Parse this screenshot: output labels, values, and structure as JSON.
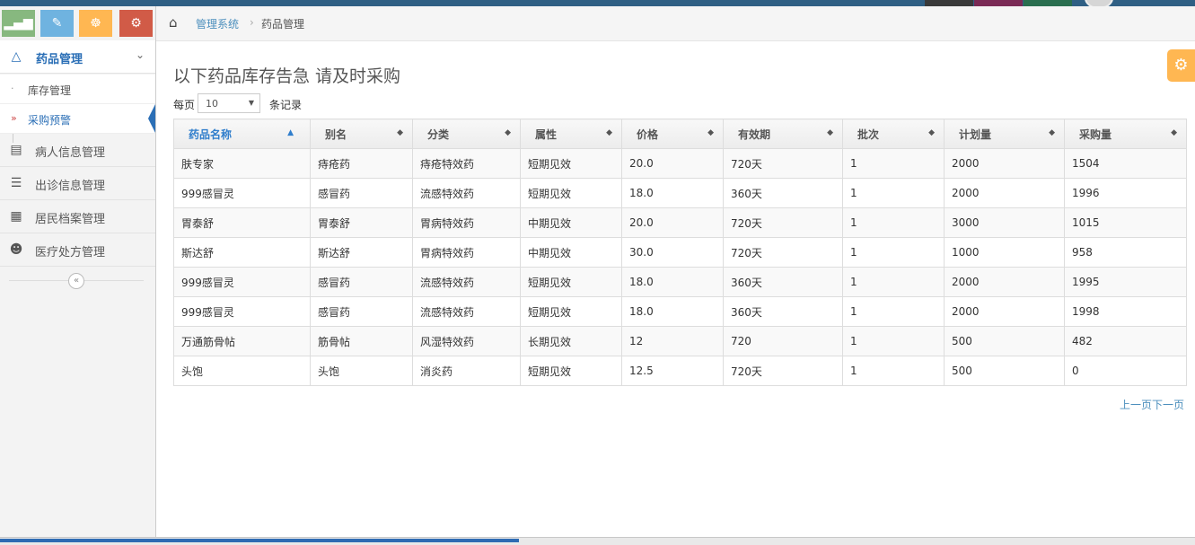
{
  "colors": {
    "accent": "#2b6fb6",
    "topbar": "#2f5f84",
    "shortcut_green": "#87b87f",
    "shortcut_blue": "#6fb3e0",
    "shortcut_orange": "#ffb752",
    "shortcut_red": "#d15b47"
  },
  "shortcuts": [
    {
      "icon": "signal-icon"
    },
    {
      "icon": "pencil-icon"
    },
    {
      "icon": "users-icon"
    },
    {
      "icon": "cogs-icon"
    }
  ],
  "sidebar": {
    "open_menu": {
      "label": "药品管理",
      "icon": "flask-icon"
    },
    "submenu": [
      {
        "label": "库存管理",
        "active": false
      },
      {
        "label": "采购预警",
        "active": true
      }
    ],
    "items": [
      {
        "label": "病人信息管理",
        "icon": "bar-chart-icon"
      },
      {
        "label": "出诊信息管理",
        "icon": "barcode-icon"
      },
      {
        "label": "居民档案管理",
        "icon": "book-icon"
      },
      {
        "label": "医疗处方管理",
        "icon": "group-icon"
      }
    ]
  },
  "breadcrumb": {
    "root": "管理系统",
    "current": "药品管理"
  },
  "main": {
    "title": "以下药品库存告急 请及时采购",
    "per_page_label": "每页",
    "per_page_value": "10",
    "per_page_suffix": "条记录",
    "pager": {
      "prev": "上一页",
      "next": "下一页"
    }
  },
  "table": {
    "columns": [
      "药品名称",
      "别名",
      "分类",
      "属性",
      "价格",
      "有效期",
      "批次",
      "计划量",
      "采购量"
    ],
    "sorted_column": 0,
    "rows": [
      [
        "肤专家",
        "痔疮药",
        "痔疮特效药",
        "短期见效",
        "20.0",
        "720天",
        "1",
        "2000",
        "1504"
      ],
      [
        "999感冒灵",
        "感冒药",
        "流感特效药",
        "短期见效",
        "18.0",
        "360天",
        "1",
        "2000",
        "1996"
      ],
      [
        "胃泰舒",
        "胃泰舒",
        "胃病特效药",
        "中期见效",
        "20.0",
        "720天",
        "1",
        "3000",
        "1015"
      ],
      [
        "斯达舒",
        "斯达舒",
        "胃病特效药",
        "中期见效",
        "30.0",
        "720天",
        "1",
        "1000",
        "958"
      ],
      [
        "999感冒灵",
        "感冒药",
        "流感特效药",
        "短期见效",
        "18.0",
        "360天",
        "1",
        "2000",
        "1995"
      ],
      [
        "999感冒灵",
        "感冒药",
        "流感特效药",
        "短期见效",
        "18.0",
        "360天",
        "1",
        "2000",
        "1998"
      ],
      [
        "万通筋骨帖",
        "筋骨帖",
        "风湿特效药",
        "长期见效",
        "12",
        "720",
        "1",
        "500",
        "482"
      ],
      [
        "头饱",
        "头饱",
        "消炎药",
        "短期见效",
        "12.5",
        "720天",
        "1",
        "500",
        "0"
      ]
    ]
  }
}
